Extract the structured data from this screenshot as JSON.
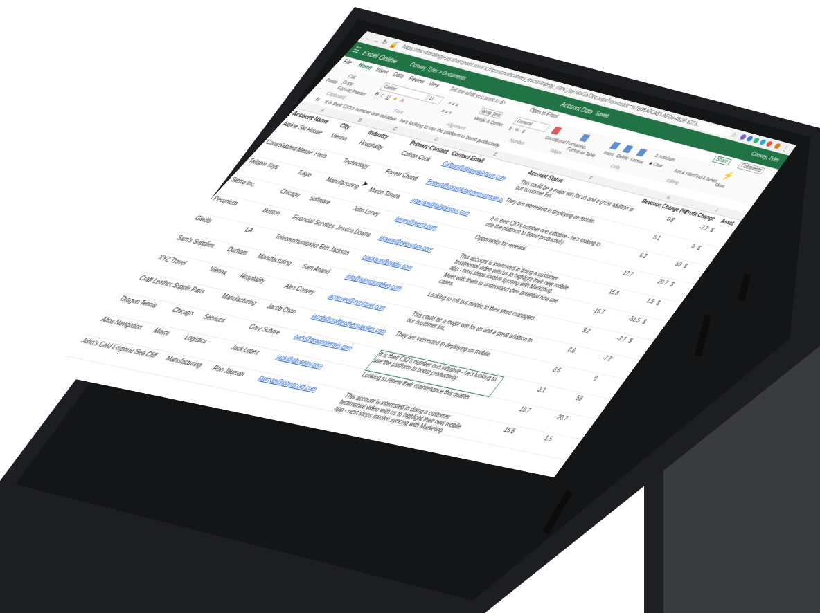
{
  "browser": {
    "url": "https://microstrategy-my.sharepoint.com/:x:/r/personal/tconvey_microstrategy_com/_layouts/15/Doc.aspx?sourcedoc=%7B8BA0CA83-AED9-4BDE-8373..."
  },
  "excel": {
    "app_name": "Excel Online",
    "breadcrumb": "Convey, Tyler > Documents",
    "doc_title": "Account Data",
    "doc_status": "Saved",
    "user": "Convey, Tyler",
    "share": "Share",
    "comments": "Comments"
  },
  "tabs": [
    "File",
    "Home",
    "Insert",
    "Data",
    "Review",
    "View"
  ],
  "tell_me": "Tell me what you want to do",
  "open_in_excel": "Open in Excel",
  "ribbon": {
    "paste": "Paste",
    "cut": "Cut",
    "copy": "Copy",
    "format_painter": "Format Painter",
    "clipboard": "Clipboard",
    "font_name": "Calibri",
    "font_size": "11",
    "font": "Font",
    "wrap_text": "Wrap Text",
    "merge_center": "Merge & Center",
    "alignment": "Alignment",
    "number_format": "General",
    "number": "Number",
    "conditional_formatting": "Conditional Formatting",
    "format_as_table": "Format as Table",
    "tables": "Tables",
    "insert": "Insert",
    "delete": "Delete",
    "format": "Format",
    "cells": "Cells",
    "autosum": "AutoSum",
    "clear": "Clear",
    "sort_filter": "Sort & Filter",
    "find_select": "Find & Select",
    "editing": "Editing",
    "ideas": "Ideas"
  },
  "formula_bar": {
    "cell_ref": "",
    "fx": "fx",
    "content": "It is their CIO's number one initiative - he's looking to use the platform to boost productivity."
  },
  "columns": [
    "A",
    "B",
    "C",
    "D",
    "E",
    "F",
    "H",
    "I"
  ],
  "headers": {
    "account_name": "Account Name",
    "city": "City",
    "industry": "Industry",
    "primary_contact": "Primary Contact",
    "contact_email": "Contact Email",
    "account_status": "Account Status",
    "revenue_change": "Revenue Change (%)",
    "profit_change": "Profit Change",
    "assets": "Asset"
  },
  "rows": [
    {
      "account": "Alpine Ski House",
      "city": "Vienna",
      "industry": "Hospitality",
      "contact": "Cathan Cook",
      "email": "Cathan@alpineskihouse.com",
      "status": "This could be a major win for us and a great addition to our customer list.",
      "revenue": "0.8",
      "profit": "-7.2",
      "asset": "$"
    },
    {
      "account": "Consolidated Messenger",
      "city": "Paris",
      "industry": "Technology",
      "contact": "Forrest Chand",
      "email": "Forrest@consolidatedmessenger.com",
      "status": "They are interested in deploying on mobile.",
      "revenue": "6.1",
      "profit": "0",
      "asset": "$"
    },
    {
      "account": "Tailspin Toys",
      "city": "Tokyo",
      "industry": "Manufacturing",
      "contact": "Marco Tanara",
      "email": "mtanara@tailspintoys.com",
      "status": "It is their CIO's number one initiative - he's looking to use the platform to boost productivity.",
      "revenue": "6.2",
      "profit": "53",
      "asset": "$"
    },
    {
      "account": "Sierra Inc.",
      "city": "Chicago",
      "industry": "Software",
      "contact": "John Leney",
      "email": "jleney@sierra.com",
      "status": "Opportunity for renewal.",
      "revenue": "17.7",
      "profit": "20.7",
      "asset": "$"
    },
    {
      "account": "Pecunium",
      "city": "Boston",
      "industry": "Financial Services",
      "contact": "Jessica Downs",
      "email": "jdowns@pecunium.com",
      "status": "This account is interested in doing a customer testimonial video with us to highlight their new mobile app - next steps involve syncing with Marketing.",
      "revenue": "15.8",
      "profit": "1.5",
      "asset": "$"
    },
    {
      "account": "Gladis",
      "city": "LA",
      "industry": "Telecommunications",
      "contact": "Erin Jackson",
      "email": "ejackson@gladis.com",
      "status": "Meet with them to understand their potential new use cases.",
      "revenue": "-16.7",
      "profit": "-51.5",
      "asset": "$"
    },
    {
      "account": "Sam's Supplies",
      "city": "Durham",
      "industry": "Manufacturing",
      "contact": "Sam Anand",
      "email": "info@samssupplies.com",
      "status": "Looking to roll out mobile to their store managers.",
      "revenue": "9.2",
      "profit": "-2.7",
      "asset": "$"
    },
    {
      "account": "XYZ Travel",
      "city": "Vienna",
      "industry": "Hospitality",
      "contact": "Alex Convey",
      "email": "aconvey@xyztravel.com",
      "status": "This could be a major win for us and a great addition to our customer list.",
      "revenue": "0.6",
      "profit": "-7.2",
      "asset": ""
    },
    {
      "account": "Craft Leather Supplies",
      "city": "Paris",
      "industry": "Manufacturing",
      "contact": "Jacob Chan",
      "email": "jacob@craftleathersupplies.com",
      "status": "They are interested in deploying on mobile.",
      "revenue": "8.6",
      "profit": "0",
      "asset": ""
    },
    {
      "account": "Dragon Tennis",
      "city": "Chicago",
      "industry": "Services",
      "contact": "Gary Schare",
      "email": "gary@dragontennis.com",
      "status": "It is their CIO's number one initiative - he's looking to use the platform to boost productivity.",
      "revenue": "3.1",
      "profit": "53",
      "asset": ""
    },
    {
      "account": "Altos Navigation",
      "city": "Miami",
      "industry": "Logistics",
      "contact": "Jack Lopez",
      "email": "jack@altosnav.com",
      "status": "Looking to renew their maintenance this quarter",
      "revenue": "19.7",
      "profit": "20.7",
      "asset": ""
    },
    {
      "account": "John's Cold Emporium",
      "city": "Sea Cliff",
      "industry": "Manufacturing",
      "contact": "Ron Jauman",
      "email": "jauman@johnscold.com",
      "status": "This account is interested in doing a customer testimonial video with us to highlight their new mobile app - next steps involve syncing with Marketing.",
      "revenue": "15.8",
      "profit": "1.5",
      "asset": ""
    }
  ],
  "colors": {
    "excel_green": "#217346",
    "device_frame": "#1e1f22",
    "stand": "#2a2b2e"
  }
}
